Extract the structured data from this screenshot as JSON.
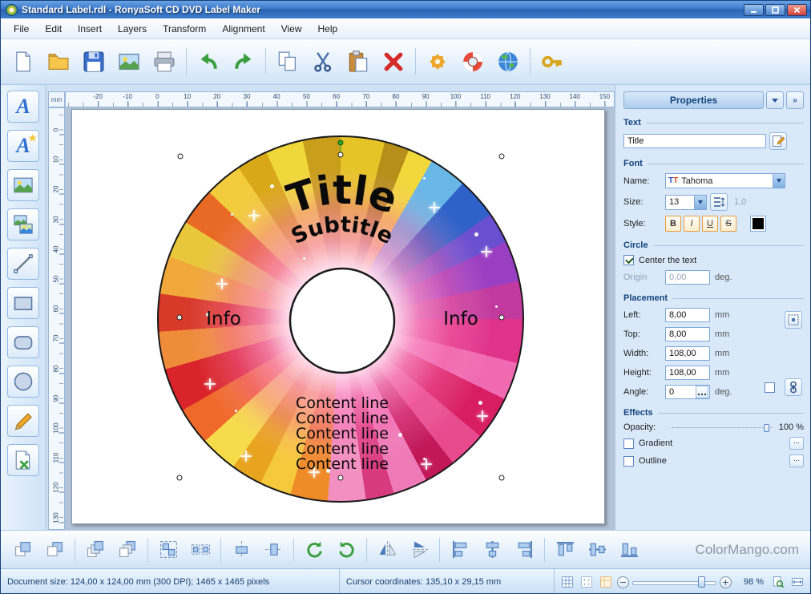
{
  "window": {
    "title": "Standard Label.rdl - RonyaSoft CD DVD Label Maker"
  },
  "menu": {
    "items": [
      "File",
      "Edit",
      "Insert",
      "Layers",
      "Transform",
      "Alignment",
      "View",
      "Help"
    ]
  },
  "toolbar": {
    "icons": [
      "new",
      "open",
      "save",
      "export-image",
      "print",
      "undo",
      "redo",
      "copy",
      "cut",
      "paste",
      "delete",
      "settings",
      "help",
      "internet",
      "key"
    ]
  },
  "tool_palette": {
    "icons": [
      "text",
      "wordart",
      "image",
      "clipart",
      "line",
      "rectangle",
      "rounded-rectangle",
      "ellipse",
      "pencil",
      "template"
    ],
    "text_glyph": "A"
  },
  "ruler": {
    "unit": "mm",
    "h_labels": [
      "-20",
      "-10",
      "0",
      "10",
      "20",
      "30",
      "40",
      "50",
      "60",
      "70",
      "80",
      "90",
      "100",
      "110",
      "120",
      "130",
      "140",
      "150"
    ],
    "v_labels": [
      "0",
      "10",
      "20",
      "30",
      "40",
      "50",
      "60",
      "70",
      "80",
      "90",
      "100",
      "110",
      "120",
      "130"
    ]
  },
  "canvas": {
    "label": {
      "title": "Title",
      "subtitle": "Subtitle",
      "info_left": "Info",
      "info_right": "Info",
      "content_lines": [
        "Content line",
        "Content line",
        "Content line",
        "Content line",
        "Content line"
      ]
    }
  },
  "properties": {
    "header": "Properties",
    "text": {
      "section": "Text",
      "value": "Title"
    },
    "font": {
      "section": "Font",
      "name_label": "Name:",
      "name_value": "Tahoma",
      "tt_glyph": "T",
      "size_label": "Size:",
      "size_value": "13",
      "spacing_value": "1,0",
      "style_label": "Style:",
      "bold": "B",
      "italic": "I",
      "underline": "U",
      "strike": "S",
      "color": "#000000"
    },
    "circle": {
      "section": "Circle",
      "center_text": "Center the text",
      "origin_label": "Origin",
      "origin_value": "0,00",
      "origin_unit": "deg."
    },
    "placement": {
      "section": "Placement",
      "rows": [
        {
          "label": "Left:",
          "value": "8,00",
          "unit": "mm"
        },
        {
          "label": "Top:",
          "value": "8,00",
          "unit": "mm"
        },
        {
          "label": "Width:",
          "value": "108,00",
          "unit": "mm"
        },
        {
          "label": "Height:",
          "value": "108,00",
          "unit": "mm"
        },
        {
          "label": "Angle:",
          "value": "0",
          "unit": "deg."
        }
      ]
    },
    "effects": {
      "section": "Effects",
      "opacity_label": "Opacity:",
      "opacity_value": "100 %",
      "gradient": "Gradient",
      "outline": "Outline",
      "more": "..."
    }
  },
  "bottom_toolbar": {
    "icons": [
      "order-raise",
      "order-lower",
      "order-front",
      "order-back",
      "group",
      "ungroup",
      "center-horizontal",
      "center-vertical",
      "rotate-left",
      "rotate-right",
      "flip-horizontal",
      "flip-vertical",
      "align-left",
      "align-center",
      "align-right",
      "align-top",
      "align-middle",
      "align-bottom"
    ],
    "watermark": "ColorMango.com"
  },
  "statusbar": {
    "document_size": "Document size: 124,00 x 124,00 mm (300 DPI); 1465 x 1465 pixels",
    "cursor_coordinates": "Cursor coordinates: 135,10 x 29,15 mm",
    "zoom_value": "98 %"
  }
}
